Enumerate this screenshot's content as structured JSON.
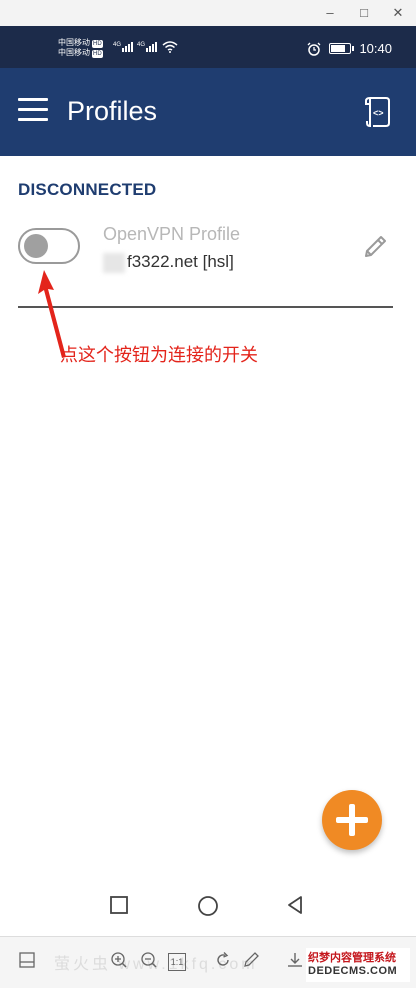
{
  "window": {
    "minimize_glyph": "–",
    "maximize_glyph": "□",
    "close_glyph": "✕"
  },
  "statusbar": {
    "carrier_1": "中国移动",
    "carrier_2": "中国移动",
    "hd_badge": "HD",
    "net_type": "4G",
    "time": "10:40",
    "battery_level": 0.85
  },
  "appbar": {
    "title": "Profiles",
    "menu_icon": "hamburger-menu-icon",
    "import_icon": "import-file-icon"
  },
  "content": {
    "section_label": "DISCONNECTED",
    "profile": {
      "name": "OpenVPN Profile",
      "server": "f3322.net [hsl]",
      "connected": false
    },
    "annotation": "点这个按钮为连接的开关"
  },
  "fab": {
    "icon": "plus-icon",
    "color": "#f08a24"
  },
  "navbar": {
    "icons": [
      "recent-apps-icon",
      "home-icon",
      "back-icon"
    ]
  },
  "toolbar": {
    "watermark_text": "萤火虫 www.1kfq.com",
    "badge_line1": "织梦内容管理系统",
    "badge_line2": "DEDECMS.COM",
    "zoom_label": "1:1"
  },
  "colors": {
    "statusbar": "#1c2b4a",
    "appbar": "#1f3d70",
    "accent": "#f08a24",
    "annotation": "#e3241b"
  }
}
